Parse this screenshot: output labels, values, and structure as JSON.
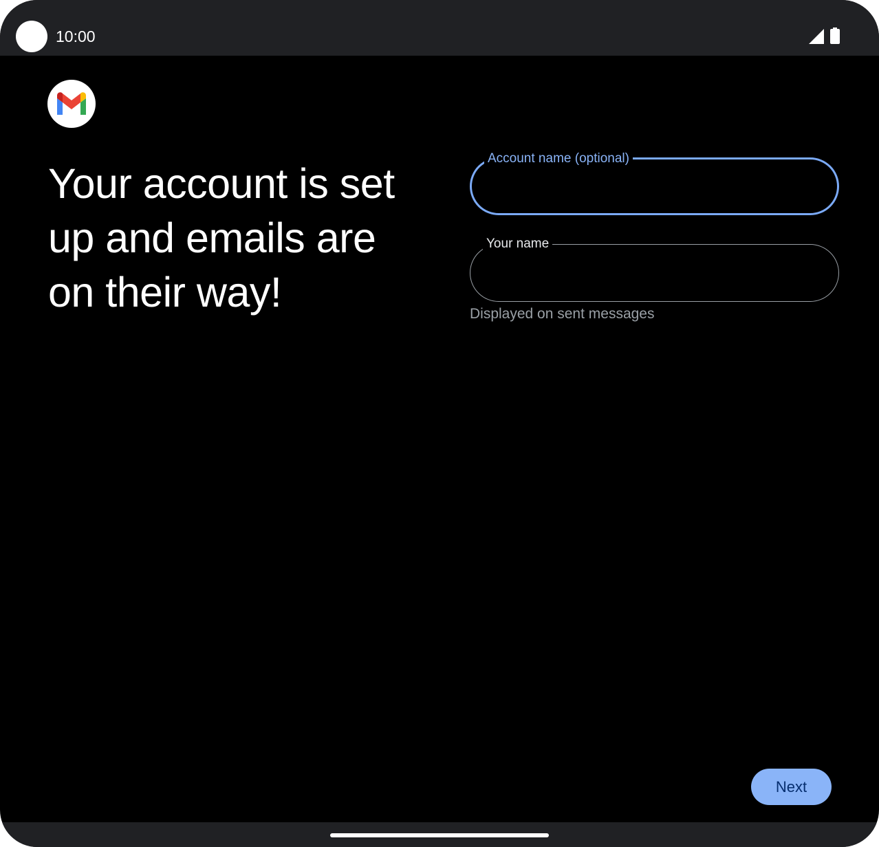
{
  "status_bar": {
    "time": "10:00",
    "icons": [
      "camera-cutout",
      "signal-icon",
      "battery-icon"
    ]
  },
  "app": {
    "logo_icon": "gmail-logo-icon"
  },
  "headline": "Your account is set up and emails are on their way!",
  "form": {
    "account_name": {
      "label": "Account name (optional)",
      "value": "",
      "focused": true
    },
    "your_name": {
      "label": "Your name",
      "value": "",
      "helper": "Displayed on sent messages"
    }
  },
  "actions": {
    "next_label": "Next"
  },
  "colors": {
    "background": "#000000",
    "system_bar": "#202124",
    "accent": "#8ab4f8",
    "button_text": "#062e6f",
    "outline": "#9aa0a6",
    "text_primary": "#ffffff",
    "text_secondary": "#9aa0a6"
  }
}
